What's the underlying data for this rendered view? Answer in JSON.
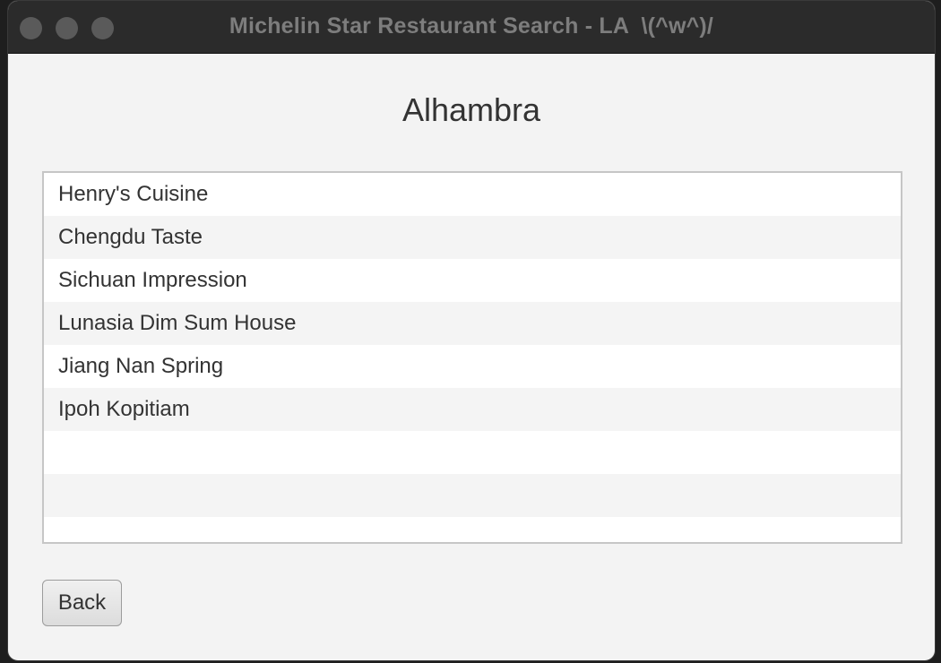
{
  "window": {
    "title": "Michelin Star Restaurant Search - LA  \\(^w^)/"
  },
  "page": {
    "title": "Alhambra"
  },
  "restaurants": [
    "Henry's Cuisine",
    "Chengdu Taste",
    "Sichuan Impression",
    "Lunasia Dim Sum House",
    "Jiang Nan Spring",
    "Ipoh Kopitiam"
  ],
  "back_button": {
    "label": "Back"
  },
  "icons": {
    "close": "close-button-icon",
    "minimize": "minimize-button-icon",
    "zoom": "zoom-button-icon"
  }
}
